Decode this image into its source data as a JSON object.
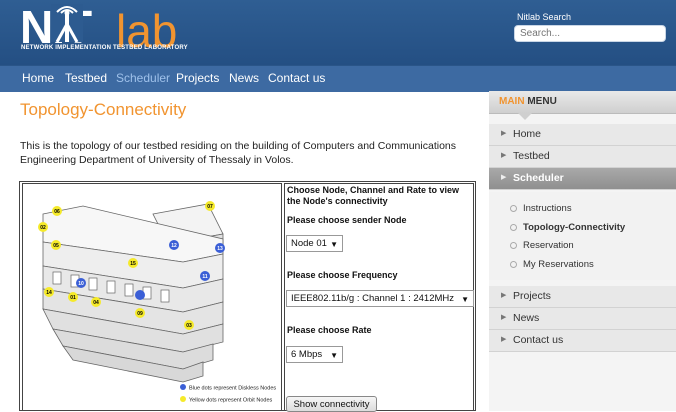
{
  "header": {
    "logo_main": "NIT",
    "logo_lab": "lab",
    "logo_sub": "NETWORK IMPLEMENTATION TESTBED LABORATORY",
    "search_label": "Nitlab Search",
    "search_placeholder": "Search..."
  },
  "nav": {
    "items": [
      {
        "label": "Home"
      },
      {
        "label": "Testbed"
      },
      {
        "label": "Scheduler",
        "active": true
      },
      {
        "label": "Projects"
      },
      {
        "label": "News"
      },
      {
        "label": "Contact us"
      }
    ]
  },
  "main": {
    "title": "Topology-Connectivity",
    "intro": "This is the topology of our testbed residing on the building of Computers and Communications Engineering Department of University of Thessaly in Volos.",
    "controls": {
      "heading": "Choose Node, Channel and Rate to view the Node's connectivity",
      "sender_label": "Please choose sender Node",
      "sender_value": "Node 01",
      "frequency_label": "Please choose Frequency",
      "frequency_value": "IEEE802.11b/g : Channel 1 : 2412MHz",
      "rate_label": "Please choose Rate",
      "rate_value": "6 Mbps",
      "button": "Show connectivity"
    },
    "map": {
      "legend_blue": "Blue dots represent Diskless Nodes",
      "legend_yellow": "Yellow dots represent Orbit Nodes",
      "node_labels": [
        "06",
        "07",
        "02",
        "05",
        "12",
        "13",
        "15",
        "11",
        "10",
        "14",
        "01",
        "04",
        "09",
        "03"
      ]
    }
  },
  "sidebar": {
    "menu_main": "MAIN",
    "menu_rest": " MENU",
    "items": [
      {
        "label": "Home"
      },
      {
        "label": "Testbed"
      },
      {
        "label": "Scheduler",
        "active": true
      }
    ],
    "submenu": [
      {
        "label": "Instructions"
      },
      {
        "label": "Topology-Connectivity",
        "current": true
      },
      {
        "label": "Reservation"
      },
      {
        "label": "My Reservations"
      }
    ],
    "items_after": [
      {
        "label": "Projects"
      },
      {
        "label": "News"
      },
      {
        "label": "Contact us"
      }
    ]
  },
  "colors": {
    "header_blue": "#2f5e93",
    "accent_orange": "#f19430",
    "blue_node": "#3b5fd6",
    "yellow_node": "#f5ea2a"
  }
}
